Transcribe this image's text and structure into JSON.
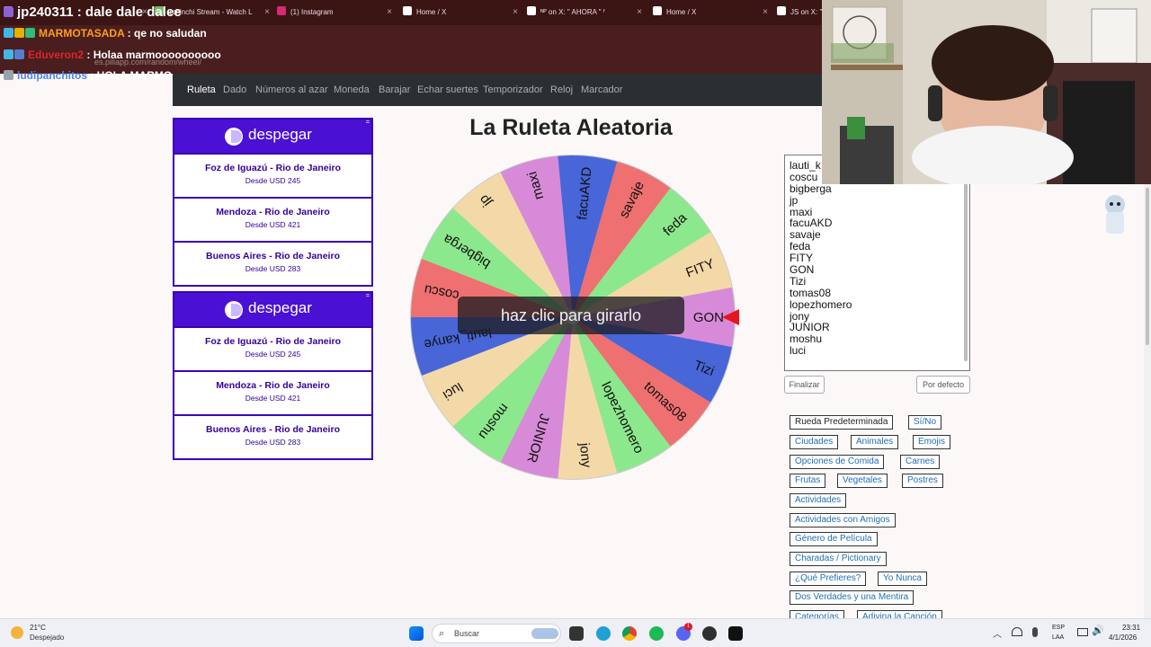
{
  "browser": {
    "tabs": [
      {
        "label": "",
        "icon_color": "#a970ff"
      },
      {
        "label": "1chinchi Stream - Watch L",
        "icon_color": "#6bbf59"
      },
      {
        "label": "(1) Instagram",
        "icon_color": "#d62976"
      },
      {
        "label": "Home / X",
        "icon_color": "#ffffff"
      },
      {
        "label": "ᴺᴾ on X: \" AHORA \" ᶠ",
        "icon_color": "#ffffff"
      },
      {
        "label": "Home / X",
        "icon_color": "#ffffff"
      },
      {
        "label": "JS on X: \"",
        "icon_color": "#ffffff"
      }
    ],
    "url": "es.piliapp.com/random/wheel/"
  },
  "chat": [
    {
      "user": "jp240311",
      "message": "dale dale dalee",
      "user_color": "#ffffff"
    },
    {
      "user": "MARMOTASADA",
      "message": "qe no saludan",
      "user_color": "#ff9f1a"
    },
    {
      "user": "Eduveron2",
      "message": "Holaa marmoooooooooo",
      "user_color": "#e0242c"
    },
    {
      "user": "ludipanchitos",
      "message": "HOLA MARMO",
      "user_color": "#4f86e8"
    }
  ],
  "nav": {
    "items": [
      "Ruleta",
      "Dado",
      "Números al azar",
      "Moneda",
      "Barajar",
      "Echar suertes",
      "Temporizador",
      "Reloj",
      "Marcador"
    ],
    "active": "Ruleta"
  },
  "ads": [
    {
      "brand": "despegar",
      "close": "=",
      "routes": [
        {
          "route": "Foz de Iguazú - Rio de Janeiro",
          "price": "Desde USD 245"
        },
        {
          "route": "Mendoza - Rio de Janeiro",
          "price": "Desde USD 421"
        },
        {
          "route": "Buenos Aires - Rio de Janeiro",
          "price": "Desde USD 283"
        }
      ]
    },
    {
      "brand": "despegar",
      "close": "=",
      "routes": [
        {
          "route": "Foz de Iguazú - Rio de Janeiro",
          "price": "Desde USD 245"
        },
        {
          "route": "Mendoza - Rio de Janeiro",
          "price": "Desde USD 421"
        },
        {
          "route": "Buenos Aires - Rio de Janeiro",
          "price": "Desde USD 283"
        }
      ]
    }
  ],
  "wheel": {
    "title": "La Ruleta Aleatoria",
    "spin_label": "haz clic para girarlo",
    "pointer_color": "#e8151b",
    "entries": [
      "lauti_kanye",
      "coscu",
      "bigberga",
      "jp",
      "maxi",
      "facuAKD",
      "savaje",
      "feda",
      "FITY",
      "GON",
      "Tizi",
      "tomas08",
      "lopezhomero",
      "jony",
      "JUNIOR",
      "moshu",
      "luci"
    ],
    "segment_colors": [
      "#4866d8",
      "#ef7070",
      "#8ce88c",
      "#f3d9a8",
      "#d78ad8",
      "#4866d8",
      "#ef7070",
      "#8ce88c",
      "#f3d9a8",
      "#d78ad8",
      "#4866d8",
      "#ef7070",
      "#8ce88c",
      "#f3d9a8",
      "#d78ad8",
      "#8ce88c",
      "#f3d9a8"
    ]
  },
  "names_panel": {
    "visible_names": [
      "lauti_k",
      "coscu",
      "bigberga",
      "jp",
      "maxi",
      "facuAKD",
      "savaje",
      "feda",
      "FITY",
      "GON",
      "Tizi",
      "tomas08",
      "lopezhomero",
      "jony",
      "JUNIOR",
      "moshu",
      "luci"
    ],
    "finish_label": "Finalizar",
    "default_label": "Por defecto"
  },
  "presets": {
    "items": [
      "Rueda Predeterminada",
      "Sí/No",
      "Ciudades",
      "Animales",
      "Emojis",
      "Opciones de Comida",
      "Carnes",
      "Frutas",
      "Vegetales",
      "Postres",
      "Actividades",
      "Actividades con Amigos",
      "Género de Película",
      "Charadas / Pictionary",
      "¿Qué Prefieres?",
      "Yo Nunca",
      "Dos Verdades y una Mentira",
      "Categorías",
      "Adivina la Canción"
    ]
  },
  "taskbar": {
    "weather_temp": "21°C",
    "weather_desc": "Despejado",
    "search_placeholder": "Buscar",
    "lang": "ESP",
    "lang_sub": "LAA",
    "time": "23:31",
    "date": "4/1/2026",
    "notif_count": "1"
  }
}
